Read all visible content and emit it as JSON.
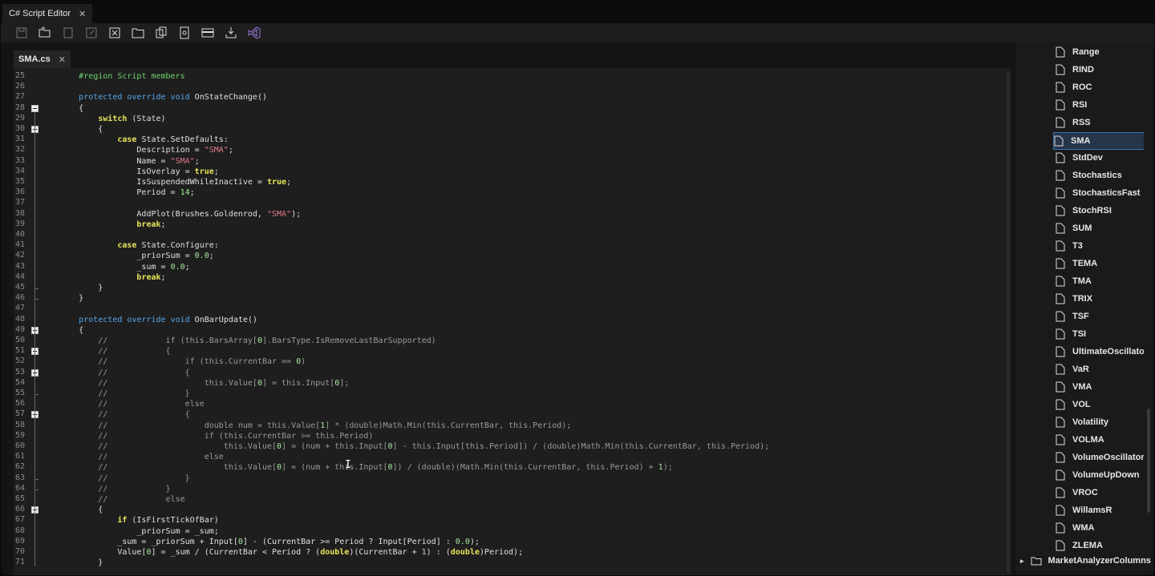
{
  "window": {
    "title": "C# Script Editor",
    "close": "✕"
  },
  "toolbar": {
    "buttons": [
      "save-icon",
      "open-folder-icon",
      "new-file-icon",
      "export-icon",
      "close-file-icon",
      "folder-icon",
      "copy-icon",
      "find-icon",
      "format-icon",
      "download-icon",
      "visual-studio-icon"
    ]
  },
  "editor": {
    "tab": {
      "label": "SMA.cs",
      "close": "✕"
    },
    "cursor_glyph": "I",
    "lines": [
      {
        "n": "25",
        "html": "        <span class=\"reg\">#region Script members</span>"
      },
      {
        "n": "26",
        "html": ""
      },
      {
        "n": "27",
        "html": "        <span class=\"kw\">protected override void</span> OnStateChange()"
      },
      {
        "n": "28",
        "html": "        {"
      },
      {
        "n": "29",
        "html": "            <span class=\"kwb\">switch</span> (State)"
      },
      {
        "n": "30",
        "html": "            {"
      },
      {
        "n": "31",
        "html": "                <span class=\"kwb\">case</span> State.SetDefaults:"
      },
      {
        "n": "32",
        "html": "                    Description = <span class=\"str\">\"SMA\"</span>;"
      },
      {
        "n": "33",
        "html": "                    Name = <span class=\"str\">\"SMA\"</span>;"
      },
      {
        "n": "34",
        "html": "                    IsOverlay = <span class=\"kwb\">true</span>;"
      },
      {
        "n": "35",
        "html": "                    IsSuspendedWhileInactive = <span class=\"kwb\">true</span>;"
      },
      {
        "n": "36",
        "html": "                    Period = <span class=\"num\">14</span>;"
      },
      {
        "n": "37",
        "html": ""
      },
      {
        "n": "38",
        "html": "                    AddPlot(Brushes.Goldenrod, <span class=\"str\">\"SMA\"</span>);"
      },
      {
        "n": "39",
        "html": "                    <span class=\"kwb\">break</span>;"
      },
      {
        "n": "40",
        "html": ""
      },
      {
        "n": "41",
        "html": "                <span class=\"kwb\">case</span> State.Configure:"
      },
      {
        "n": "42",
        "html": "                    _priorSum = <span class=\"num\">0.0</span>;"
      },
      {
        "n": "43",
        "html": "                    _sum = <span class=\"num\">0.0</span>;"
      },
      {
        "n": "44",
        "html": "                    <span class=\"kwb\">break</span>;"
      },
      {
        "n": "45",
        "html": "            }"
      },
      {
        "n": "46",
        "html": "        }"
      },
      {
        "n": "47",
        "html": ""
      },
      {
        "n": "48",
        "html": "        <span class=\"kw\">protected override void</span> OnBarUpdate()"
      },
      {
        "n": "49",
        "html": "        {"
      },
      {
        "n": "50",
        "html": "<span class=\"cm\">            //            if (this.BarsArray[<span class=\"num\">0</span>].BarsType.IsRemoveLastBarSupported)</span>"
      },
      {
        "n": "51",
        "html": "<span class=\"cm\">            //            {</span>"
      },
      {
        "n": "52",
        "html": "<span class=\"cm\">            //                if (this.CurrentBar == <span class=\"num\">0</span>)</span>"
      },
      {
        "n": "53",
        "html": "<span class=\"cm\">            //                {</span>"
      },
      {
        "n": "54",
        "html": "<span class=\"cm\">            //                    this.Value[<span class=\"num\">0</span>] = this.Input[<span class=\"num\">0</span>];</span>"
      },
      {
        "n": "55",
        "html": "<span class=\"cm\">            //                }</span>"
      },
      {
        "n": "56",
        "html": "<span class=\"cm\">            //                else</span>"
      },
      {
        "n": "57",
        "html": "<span class=\"cm\">            //                {</span>"
      },
      {
        "n": "58",
        "html": "<span class=\"cm\">            //                    double num = this.Value[<span class=\"num\">1</span>] * (double)Math.Min(this.CurrentBar, this.Period);</span>"
      },
      {
        "n": "59",
        "html": "<span class=\"cm\">            //                    if (this.CurrentBar &gt;= this.Period)</span>"
      },
      {
        "n": "60",
        "html": "<span class=\"cm\">            //                        this.Value[<span class=\"num\">0</span>] = (num + this.Input[<span class=\"num\">0</span>] - this.Input[this.Period]) / (double)Math.Min(this.CurrentBar, this.Period);</span>"
      },
      {
        "n": "61",
        "html": "<span class=\"cm\">            //                    else</span>"
      },
      {
        "n": "62",
        "html": "<span class=\"cm\">            //                        this.Value[<span class=\"num\">0</span>] = (num + this.Input[<span class=\"num\">0</span>]) / (double)(Math.Min(this.CurrentBar, this.Period) + <span class=\"num\">1</span>);</span>"
      },
      {
        "n": "63",
        "html": "<span class=\"cm\">            //                }</span>"
      },
      {
        "n": "64",
        "html": "<span class=\"cm\">            //            }</span>"
      },
      {
        "n": "65",
        "html": "<span class=\"cm\">            //            else</span>"
      },
      {
        "n": "66",
        "html": "            {"
      },
      {
        "n": "67",
        "html": "                <span class=\"kwb\">if</span> (IsFirstTickOfBar)"
      },
      {
        "n": "68",
        "html": "                    _priorSum = _sum;"
      },
      {
        "n": "69",
        "html": "                _sum = _priorSum + Input[<span class=\"num\">0</span>] - (CurrentBar &gt;= Period ? Input[Period] : <span class=\"num\">0.0</span>);"
      },
      {
        "n": "70",
        "html": "                Value[<span class=\"num\">0</span>] = _sum / (CurrentBar &lt; Period ? (<span class=\"kwb\">double</span>)(CurrentBar + <span class=\"num\">1</span>) : (<span class=\"kwb\">double</span>)Period);"
      },
      {
        "n": "71",
        "html": "            }"
      }
    ],
    "fold_boxes": [
      "28",
      "30",
      "49",
      "51",
      "53",
      "57",
      "66"
    ],
    "fold_ends": [
      "45",
      "46",
      "55",
      "63",
      "64"
    ]
  },
  "explorer": {
    "items": [
      "Range",
      "RIND",
      "ROC",
      "RSI",
      "RSS",
      "SMA",
      "StdDev",
      "Stochastics",
      "StochasticsFast",
      "StochRSI",
      "SUM",
      "T3",
      "TEMA",
      "TMA",
      "TRIX",
      "TSF",
      "TSI",
      "UltimateOscillato",
      "VaR",
      "VMA",
      "VOL",
      "Volatility",
      "VOLMA",
      "VolumeOscillator",
      "VolumeUpDown",
      "VROC",
      "WillamsR",
      "WMA",
      "ZLEMA"
    ],
    "selected": "SMA",
    "folder": {
      "label": "MarketAnalyzerColumns",
      "expander": "▸"
    }
  }
}
